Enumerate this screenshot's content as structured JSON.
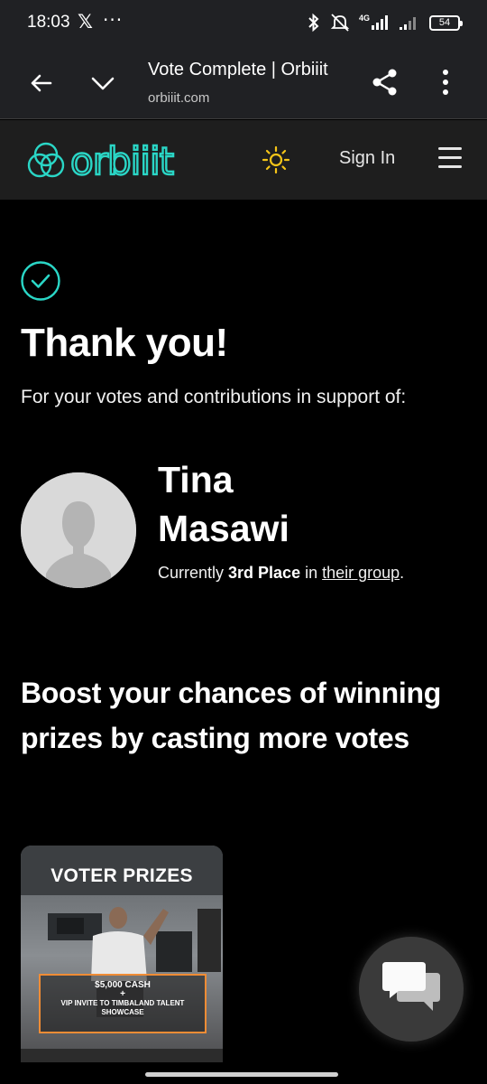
{
  "status_bar": {
    "time": "18:03",
    "x_logo": "𝕏",
    "dots": "···",
    "network": "4G",
    "battery": "54",
    "icons": [
      "bluetooth-icon",
      "mute-icon",
      "signal-icon",
      "signal-icon-2",
      "battery-icon"
    ]
  },
  "browser": {
    "title": "Vote Complete | Orbiiit",
    "url": "orbiiit.com"
  },
  "header": {
    "logo_text": "orbiiit",
    "signin_label": "Sign In"
  },
  "confirmation": {
    "title": "Thank you!",
    "subtitle": "For your votes and contributions in support of:"
  },
  "candidate": {
    "first_name": "Tina",
    "last_name": "Masawi",
    "status_prefix": "Currently ",
    "place": "3rd Place",
    "status_mid": " in ",
    "group_link": "their group",
    "status_suffix": "."
  },
  "boost": {
    "headline": "Boost your chances of winning prizes by casting more votes"
  },
  "prize_card": {
    "title": "VOTER PRIZES",
    "cash": "$5,000 CASH",
    "plus": "+",
    "vip": "VIP INVITE TO TIMBALAND TALENT SHOWCASE"
  },
  "colors": {
    "accent": "#2ad6c6",
    "sun": "#f5c518",
    "prize_border": "#f08c35",
    "header_bg": "#1e1e1e",
    "browser_bg": "#202124"
  }
}
